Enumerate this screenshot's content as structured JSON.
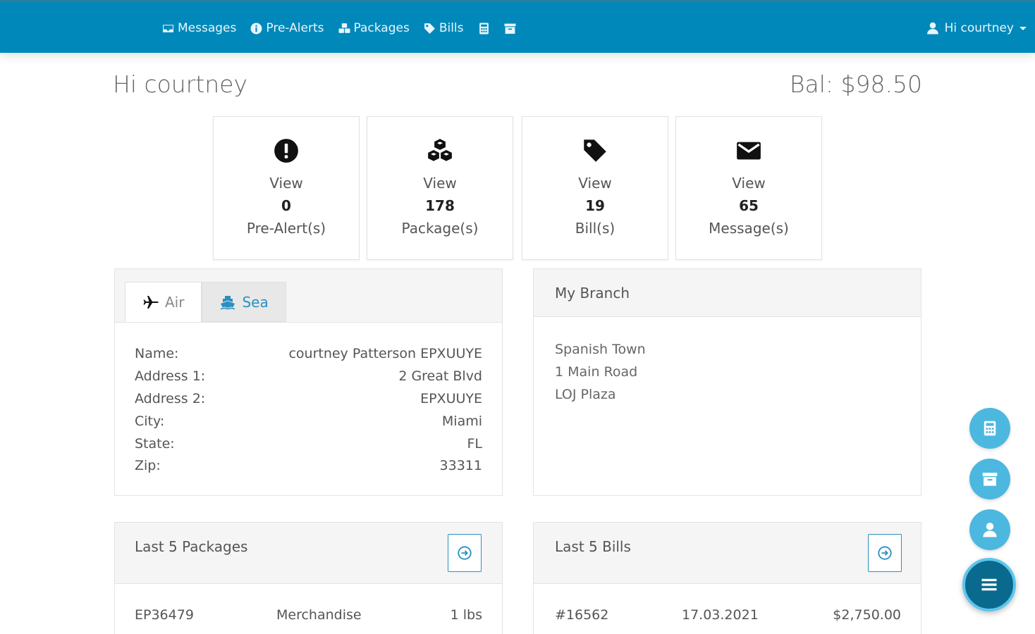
{
  "nav": {
    "messages": "Messages",
    "prealerts": "Pre-Alerts",
    "packages": "Packages",
    "bills": "Bills",
    "calculator_icon": "calculator-icon",
    "archive_icon": "archive-icon",
    "user_label": "Hi courtney"
  },
  "greeting": "Hi courtney",
  "balance": "Bal: $98.50",
  "stats": [
    {
      "view": "View",
      "count": "0",
      "label": "Pre-Alert(s)",
      "icon": "exclamation-circle-icon"
    },
    {
      "view": "View",
      "count": "178",
      "label": "Package(s)",
      "icon": "cubes-icon"
    },
    {
      "view": "View",
      "count": "19",
      "label": "Bill(s)",
      "icon": "tag-icon"
    },
    {
      "view": "View",
      "count": "65",
      "label": "Message(s)",
      "icon": "envelope-icon"
    }
  ],
  "address_panel": {
    "tabs": [
      "Air",
      "Sea"
    ],
    "fields": [
      {
        "label": "Name:",
        "value": "courtney Patterson EPXUUYE"
      },
      {
        "label": "Address 1:",
        "value": "2 Great Blvd"
      },
      {
        "label": "Address 2:",
        "value": "EPXUUYE"
      },
      {
        "label": "City:",
        "value": "Miami"
      },
      {
        "label": "State:",
        "value": "FL"
      },
      {
        "label": "Zip:",
        "value": "33311"
      }
    ]
  },
  "branch": {
    "title": "My Branch",
    "lines": [
      "Spanish Town",
      "1 Main Road",
      "LOJ Plaza"
    ]
  },
  "packages_panel": {
    "title": "Last 5 Packages",
    "rows": [
      {
        "id": "EP36479",
        "type": "Merchandise",
        "weight": "1 lbs"
      }
    ]
  },
  "bills_panel": {
    "title": "Last 5 Bills",
    "rows": [
      {
        "id": "#16562",
        "date": "17.03.2021",
        "amount": "$2,750.00"
      }
    ]
  },
  "colors": {
    "topbar": "#0088bb",
    "accent": "#2a90c0",
    "fab": "#4cb8e0",
    "fab_main": "#0a6a8e"
  }
}
